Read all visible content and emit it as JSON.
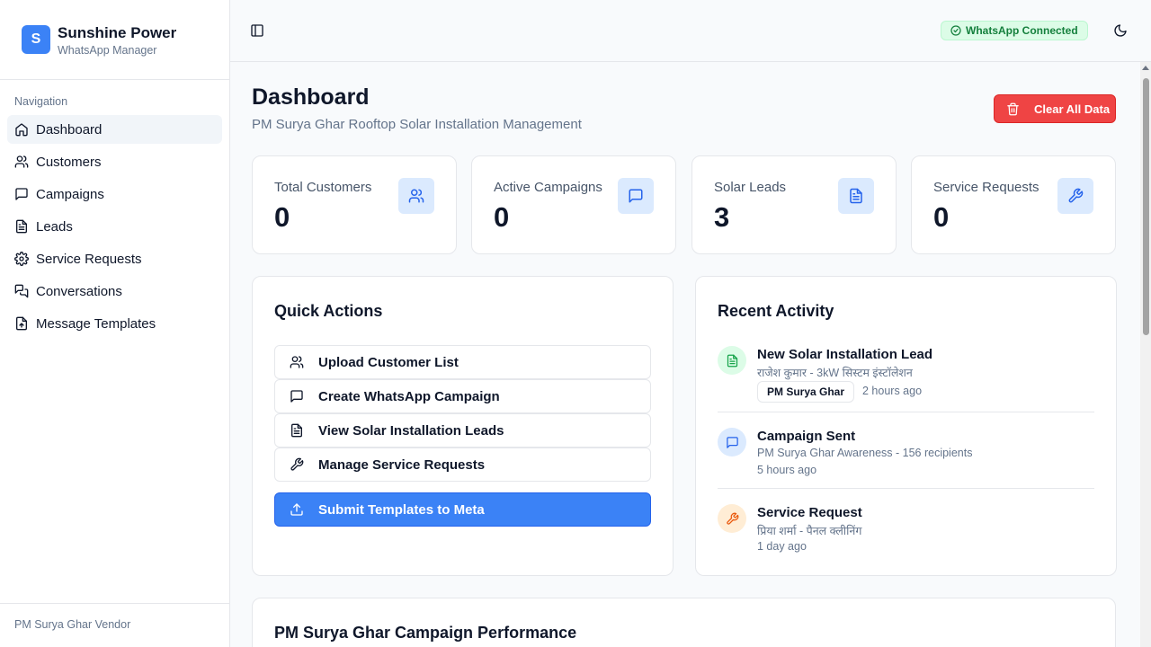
{
  "brand": {
    "logo_letter": "S",
    "name": "Sunshine Power",
    "subtitle": "WhatsApp Manager"
  },
  "sidebar": {
    "heading": "Navigation",
    "items": [
      {
        "label": "Dashboard",
        "icon": "home-icon",
        "active": true
      },
      {
        "label": "Customers",
        "icon": "users-icon"
      },
      {
        "label": "Campaigns",
        "icon": "message-square-icon"
      },
      {
        "label": "Leads",
        "icon": "file-text-icon"
      },
      {
        "label": "Service Requests",
        "icon": "gear-icon"
      },
      {
        "label": "Conversations",
        "icon": "messages-icon"
      },
      {
        "label": "Message Templates",
        "icon": "file-upload-icon"
      }
    ],
    "footer": "PM Surya Ghar Vendor"
  },
  "topbar": {
    "status_badge": "WhatsApp Connected"
  },
  "page": {
    "title": "Dashboard",
    "subtitle": "PM Surya Ghar Rooftop Solar Installation Management",
    "clear_button": "Clear All Data"
  },
  "stats": [
    {
      "label": "Total Customers",
      "value": "0",
      "icon": "users-icon"
    },
    {
      "label": "Active Campaigns",
      "value": "0",
      "icon": "message-square-icon"
    },
    {
      "label": "Solar Leads",
      "value": "3",
      "icon": "file-text-icon"
    },
    {
      "label": "Service Requests",
      "value": "0",
      "icon": "wrench-icon"
    }
  ],
  "quick_actions": {
    "title": "Quick Actions",
    "items": [
      {
        "label": "Upload Customer List",
        "icon": "users-icon"
      },
      {
        "label": "Create WhatsApp Campaign",
        "icon": "message-square-icon"
      },
      {
        "label": "View Solar Installation Leads",
        "icon": "file-text-icon"
      },
      {
        "label": "Manage Service Requests",
        "icon": "wrench-icon"
      }
    ],
    "primary": {
      "label": "Submit Templates to Meta",
      "icon": "upload-icon"
    }
  },
  "recent_activity": {
    "title": "Recent Activity",
    "items": [
      {
        "title": "New Solar Installation Lead",
        "description": "राजेश कुमार - 3kW सिस्टम इंस्टॉलेशन",
        "tag": "PM Surya Ghar",
        "time": "2 hours ago",
        "icon": "file-text-icon",
        "color": "#16a34a"
      },
      {
        "title": "Campaign Sent",
        "description": "PM Surya Ghar Awareness - 156 recipients",
        "time": "5 hours ago",
        "icon": "message-square-icon",
        "color": "#2563eb"
      },
      {
        "title": "Service Request",
        "description": "प्रिया शर्मा - पैनल क्लीनिंग",
        "time": "1 day ago",
        "icon": "wrench-icon",
        "color": "#ea580c"
      }
    ]
  },
  "performance": {
    "title": "PM Surya Ghar Campaign Performance"
  },
  "colors": {
    "primary": "#3b82f6",
    "danger": "#ef4444",
    "success_bg": "#dcfce7",
    "success_text": "#15803d"
  }
}
